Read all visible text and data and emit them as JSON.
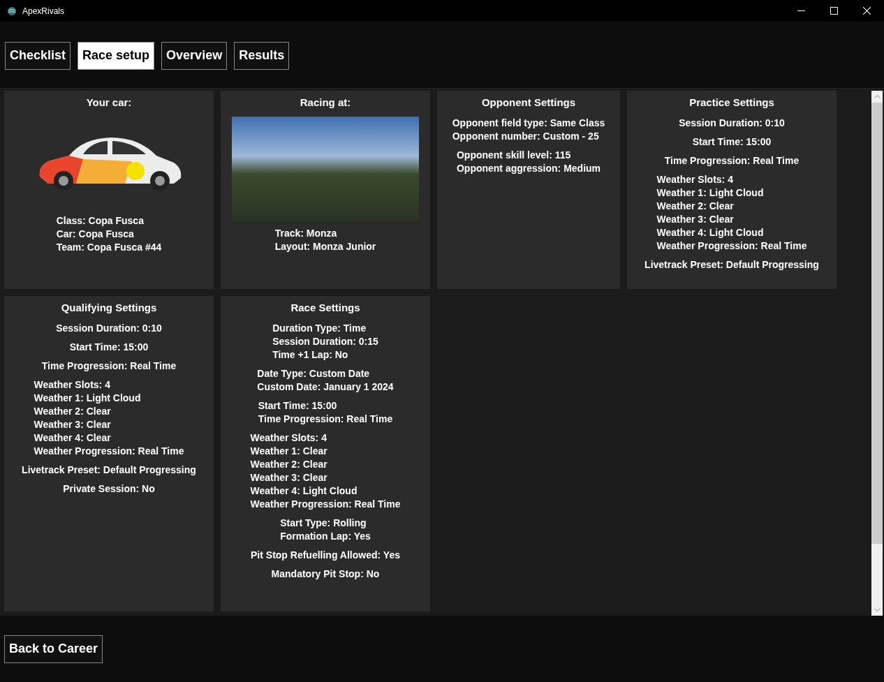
{
  "window": {
    "title": "ApexRivals"
  },
  "tabs": [
    {
      "label": "Checklist",
      "selected": false
    },
    {
      "label": "Race setup",
      "selected": true
    },
    {
      "label": "Overview",
      "selected": false
    },
    {
      "label": "Results",
      "selected": false
    }
  ],
  "cards": [
    {
      "kind": "car",
      "title": "Your car:",
      "groups": [
        [
          "Class: Copa Fusca",
          "Car: Copa Fusca",
          "Team: Copa Fusca #44"
        ]
      ]
    },
    {
      "kind": "track",
      "title": "Racing at:",
      "groups": [
        [
          "Track: Monza",
          "Layout: Monza Junior"
        ]
      ]
    },
    {
      "kind": "text",
      "title": "Opponent Settings",
      "groups": [
        [
          "Opponent field type: Same Class",
          "Opponent number: Custom - 25"
        ],
        [
          "Opponent skill level: 115",
          "Opponent aggression: Medium"
        ]
      ]
    },
    {
      "kind": "text",
      "title": "Practice Settings",
      "groups": [
        [
          "Session Duration: 0:10"
        ],
        [
          "Start Time: 15:00"
        ],
        [
          "Time Progression: Real Time"
        ],
        [
          "Weather Slots: 4",
          "Weather 1: Light Cloud",
          "Weather 2: Clear",
          "Weather 3: Clear",
          "Weather 4: Light Cloud",
          "Weather Progression: Real Time"
        ],
        [
          "Livetrack Preset: Default Progressing"
        ]
      ]
    },
    {
      "kind": "text",
      "title": "Qualifying Settings",
      "groups": [
        [
          "Session Duration: 0:10"
        ],
        [
          "Start Time: 15:00"
        ],
        [
          "Time Progression: Real Time"
        ],
        [
          "Weather Slots: 4",
          "Weather 1: Light Cloud",
          "Weather 2: Clear",
          "Weather 3: Clear",
          "Weather 4: Clear",
          "Weather Progression: Real Time"
        ],
        [
          "Livetrack Preset: Default Progressing"
        ],
        [
          "Private Session: No"
        ]
      ]
    },
    {
      "kind": "text",
      "title": "Race Settings",
      "groups": [
        [
          "Duration Type: Time",
          "Session Duration: 0:15",
          "Time +1 Lap: No"
        ],
        [
          "Date Type: Custom Date",
          "Custom Date: January 1 2024"
        ],
        [
          "Start Time: 15:00",
          "Time Progression: Real Time"
        ],
        [
          "Weather Slots: 4",
          "Weather 1: Clear",
          "Weather 2: Clear",
          "Weather 3: Clear",
          "Weather 4: Light Cloud",
          "Weather Progression: Real Time"
        ],
        [
          "Start Type: Rolling",
          "Formation Lap: Yes"
        ],
        [
          "Pit Stop Refuelling Allowed: Yes"
        ],
        [
          "Mandatory Pit Stop: No"
        ]
      ]
    }
  ],
  "footer_button": "Back to Career"
}
